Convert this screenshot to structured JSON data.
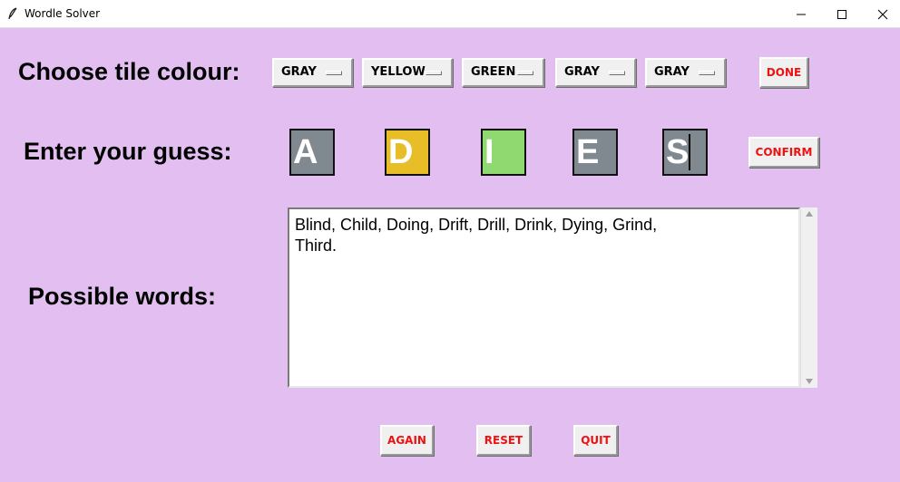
{
  "window": {
    "title": "Wordle Solver",
    "icon": "feather-icon"
  },
  "labels": {
    "choose_colour": "Choose tile colour:",
    "enter_guess": "Enter your guess:",
    "possible_words": "Possible words:"
  },
  "colour_selectors": [
    {
      "selected": "GRAY"
    },
    {
      "selected": "YELLOW"
    },
    {
      "selected": "GREEN"
    },
    {
      "selected": "GRAY"
    },
    {
      "selected": "GRAY"
    }
  ],
  "buttons": {
    "done": "DONE",
    "confirm": "CONFIRM",
    "again": "AGAIN",
    "reset": "RESET",
    "quit": "QUIT"
  },
  "tiles": [
    {
      "letter": "A",
      "colour": "#808890"
    },
    {
      "letter": "D",
      "colour": "#e8be28"
    },
    {
      "letter": "I",
      "colour": "#90d870"
    },
    {
      "letter": "E",
      "colour": "#808890"
    },
    {
      "letter": "S",
      "colour": "#808890"
    }
  ],
  "possible_words": {
    "line1": "Blind, Child, Doing, Drift, Drill, Drink, Dying, Grind,",
    "line2": "Third."
  },
  "colors": {
    "background": "#e2bff0",
    "button_text": "#ee1111"
  }
}
